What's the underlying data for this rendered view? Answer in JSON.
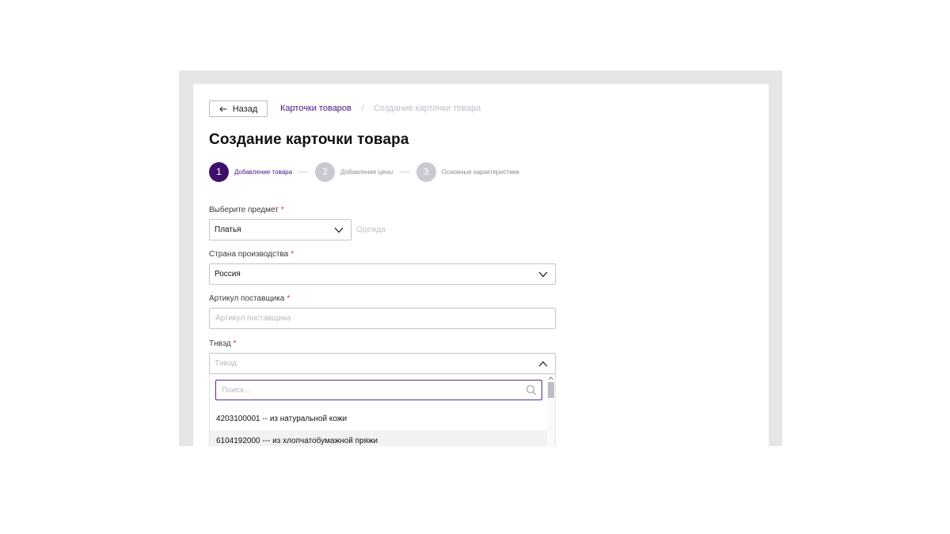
{
  "nav": {
    "back_label": "Назад",
    "breadcrumb_link": "Карточки товаров",
    "breadcrumb_separator": "/",
    "breadcrumb_current": "Создание карточки товара"
  },
  "page_title": "Создание карточки товара",
  "stepper": {
    "steps": [
      {
        "number": "1",
        "label": "Добавление товара",
        "state": "active"
      },
      {
        "number": "2",
        "label": "Добавление цены",
        "state": "inactive"
      },
      {
        "number": "3",
        "label": "Основные характеристики",
        "state": "inactive"
      }
    ]
  },
  "form": {
    "subject": {
      "label": "Выберите предмет",
      "required_mark": "*",
      "value": "Платья",
      "hint": "Одежда"
    },
    "country": {
      "label": "Страна производства",
      "required_mark": "*",
      "value": "Россия"
    },
    "article": {
      "label": "Артикул поставщика",
      "required_mark": "*",
      "placeholder": "Артикул поставщика",
      "value": ""
    },
    "tnved": {
      "label": "Тнвэд",
      "required_mark": "*",
      "placeholder": "Тнвэд",
      "dropdown": {
        "search_placeholder": "Поиск...",
        "options": [
          "4203100001 -- из натуральной кожи",
          "6104192000 --- из хлопчатобумажной пряжи"
        ],
        "hovered_index": 1
      }
    }
  },
  "colors": {
    "accent": "#3d0f6b",
    "link": "#4b1580",
    "required": "#e0245e",
    "step_inactive": "#c9c9d1"
  }
}
